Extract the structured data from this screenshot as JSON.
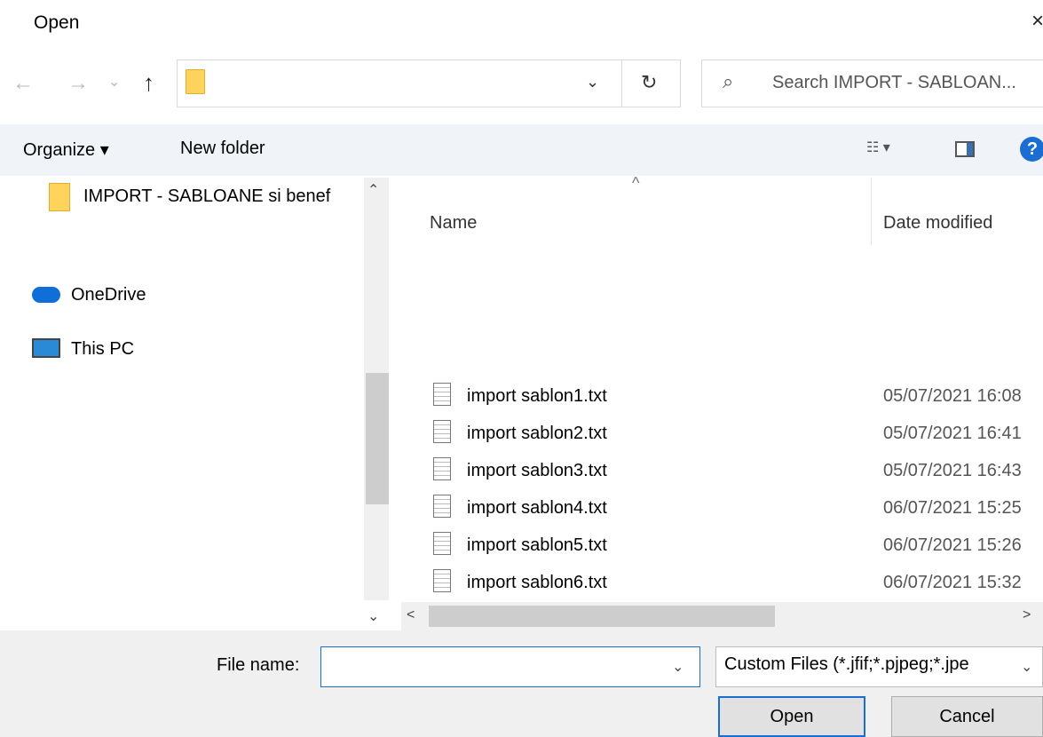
{
  "window": {
    "title": "Open",
    "close_glyph": "×"
  },
  "nav": {
    "back_glyph": "←",
    "forward_glyph": "→",
    "recent_glyph": "⌄",
    "up_glyph": "↑",
    "address": {
      "value": "",
      "dropdown_glyph": "⌄",
      "refresh_glyph": "↻"
    },
    "search": {
      "placeholder": "Search IMPORT - SABLOAN...",
      "icon": "search-icon"
    }
  },
  "toolbar": {
    "organize_label": "Organize ▾",
    "new_folder_label": "New folder",
    "views_glyph": "☷ ▾",
    "help_label": "?"
  },
  "sidebar": {
    "items": [
      {
        "label": "IMPORT  - SABLOANE si benef",
        "icon": "folder-icon"
      },
      {
        "label": "OneDrive",
        "icon": "onedrive-icon"
      },
      {
        "label": "This PC",
        "icon": "pc-icon"
      }
    ],
    "scroll_up": "⌃",
    "scroll_down": "⌄"
  },
  "file_list": {
    "columns": {
      "name": "Name",
      "date_modified": "Date modified",
      "sort_glyph": "^"
    },
    "rows": [
      {
        "name": "import sablon1.txt",
        "date": "05/07/2021 16:08"
      },
      {
        "name": "import sablon2.txt",
        "date": "05/07/2021 16:41"
      },
      {
        "name": "import sablon3.txt",
        "date": "05/07/2021 16:43"
      },
      {
        "name": "import sablon4.txt",
        "date": "06/07/2021 15:25"
      },
      {
        "name": "import sablon5.txt",
        "date": "06/07/2021 15:26"
      },
      {
        "name": "import sablon6.txt",
        "date": "06/07/2021 15:32"
      }
    ],
    "hscroll_left": "<",
    "hscroll_right": ">"
  },
  "footer": {
    "file_name_label": "File name:",
    "file_name_value": "",
    "file_name_dropdown": "⌄",
    "filter_value": "Custom Files (*.jfif;*.pjpeg;*.jpe",
    "filter_dropdown": "⌄",
    "open_label": "Open",
    "cancel_label": "Cancel"
  }
}
